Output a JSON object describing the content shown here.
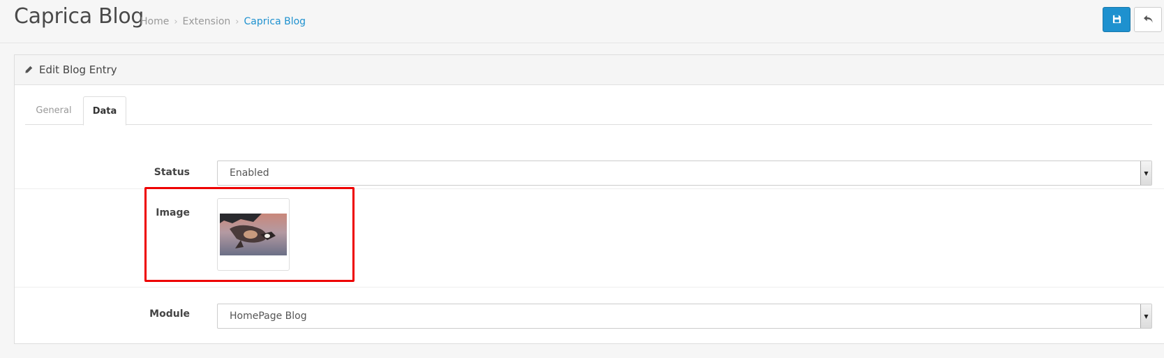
{
  "header": {
    "title": "Caprica Blog",
    "breadcrumb": [
      "Home",
      "Extension",
      "Caprica Blog"
    ],
    "save_icon": "save-icon",
    "back_icon": "reply-icon"
  },
  "panel": {
    "title": "Edit Blog Entry",
    "title_icon": "pencil-icon"
  },
  "tabs": [
    {
      "label": "General",
      "active": false
    },
    {
      "label": "Data",
      "active": true
    }
  ],
  "form": {
    "status": {
      "label": "Status",
      "value": "Enabled"
    },
    "image": {
      "label": "Image"
    },
    "module": {
      "label": "Module",
      "value": "HomePage Blog"
    }
  },
  "colors": {
    "primary": "#1e91cf",
    "highlight": "#ee0000"
  }
}
